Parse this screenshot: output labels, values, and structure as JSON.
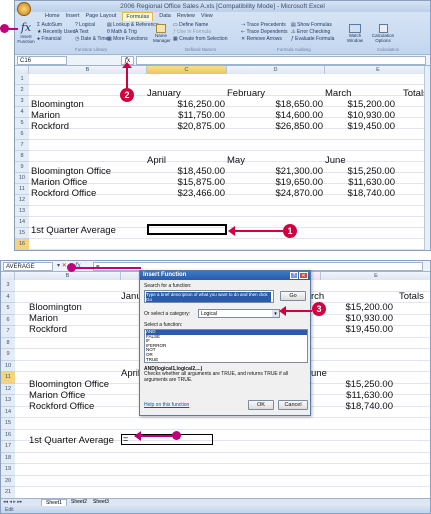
{
  "top": {
    "title": "2006 Regional Office Sales A.xls [Compatibility Mode] - Microsoft Excel",
    "tabs": [
      "Home",
      "Insert",
      "Page Layout",
      "Formulas",
      "Data",
      "Review",
      "View"
    ],
    "ribbon": {
      "insert_function": "Insert Function",
      "autosum": "AutoSum",
      "recently_used": "Recently Used",
      "financial": "Financial",
      "logical": "Logical",
      "text": "Text",
      "date_time": "Date & Time",
      "lookup": "Lookup & Reference",
      "math": "Math & Trig",
      "more_functions": "More Functions",
      "library_label": "Function Library",
      "name_manager": "Name Manager",
      "define_name": "Define Name",
      "use_in_formula": "Use in Formula",
      "create_from_selection": "Create from Selection",
      "defined_names_label": "Defined Names",
      "trace_precedents": "Trace Precedents",
      "trace_dependents": "Trace Dependents",
      "remove_arrows": "Remove Arrows",
      "show_formulas": "Show Formulas",
      "error_checking": "Error Checking",
      "evaluate_formula": "Evaluate Formula",
      "formula_auditing_label": "Formula Auditing",
      "watch_window": "Watch Window",
      "calc_options": "Calculation Options",
      "calculation_label": "Calculation"
    },
    "name_box": "C16",
    "columns": [
      "B",
      "C",
      "D",
      "E"
    ],
    "rows": [
      "1",
      "2",
      "3",
      "4",
      "5",
      "6",
      "7",
      "8",
      "9",
      "10",
      "11",
      "12",
      "13",
      "14",
      "15",
      "16",
      "17"
    ],
    "headers_q1": [
      "January",
      "February",
      "March",
      "Totals"
    ],
    "headers_q2": [
      "April",
      "May",
      "June"
    ],
    "table1": [
      {
        "label": "Bloomington",
        "jan": "$16,250.00",
        "feb": "$18,650.00",
        "mar": "$15,200.00"
      },
      {
        "label": "Marion",
        "jan": "$11,750.00",
        "feb": "$14,600.00",
        "mar": "$10,930.00"
      },
      {
        "label": "Rockford",
        "jan": "$20,875.00",
        "feb": "$26,850.00",
        "mar": "$19,450.00"
      }
    ],
    "table2": [
      {
        "label": "Bloomington Office",
        "apr": "$18,450.00",
        "may": "$21,300.00",
        "jun": "$15,250.00"
      },
      {
        "label": "Marion Office",
        "apr": "$15,875.00",
        "may": "$19,650.00",
        "jun": "$11,630.00"
      },
      {
        "label": "Rockford Office",
        "apr": "$23,466.00",
        "may": "$24,870.00",
        "jun": "$18,740.00"
      }
    ],
    "avg_label": "1st Quarter Average",
    "marker1": "1",
    "marker2": "2"
  },
  "bottom": {
    "name_box": "AVERAGE",
    "formula": "=",
    "rows": [
      "3",
      "4",
      "5",
      "6",
      "7",
      "8",
      "9",
      "10",
      "11",
      "12",
      "13",
      "14",
      "15",
      "16",
      "17",
      "18",
      "19",
      "20",
      "21"
    ],
    "totals": "Totals",
    "jan_partial": "Janu",
    "apr_partial": "April",
    "march_partial": "rch",
    "june_partial": "une",
    "left_labels": [
      "Bloomington",
      "Marion",
      "Rockford",
      "Bloomington Office",
      "Marion Office",
      "Rockford Office"
    ],
    "right_values": [
      "$15,200.00",
      "$10,930.00",
      "$19,450.00",
      "$15,250.00",
      "$11,630.00",
      "$18,740.00"
    ],
    "avg_label": "1st Quarter Average",
    "avg_value": "=",
    "dialog": {
      "title": "Insert Function",
      "search_label": "Search for a function:",
      "search_value": "Type a brief description of what you want to do and then click Go",
      "go": "Go",
      "category_label": "Or select a category:",
      "category_value": "Logical",
      "select_label": "Select a function:",
      "functions": [
        "AND",
        "FALSE",
        "IF",
        "IFERROR",
        "NOT",
        "OR",
        "TRUE"
      ],
      "signature": "AND(logical1,logical2,...)",
      "description": "Checks whether all arguments are TRUE, and returns TRUE if all arguments are TRUE.",
      "help": "Help on this function",
      "ok": "OK",
      "cancel": "Cancel"
    },
    "sheet_tabs": [
      "Sheet1",
      "Sheet2",
      "Sheet3"
    ],
    "status": "Edit",
    "marker3": "3"
  },
  "colors": {
    "marker": "#d3003f",
    "dot": "#c0007a",
    "selection": "#3c78c8"
  }
}
